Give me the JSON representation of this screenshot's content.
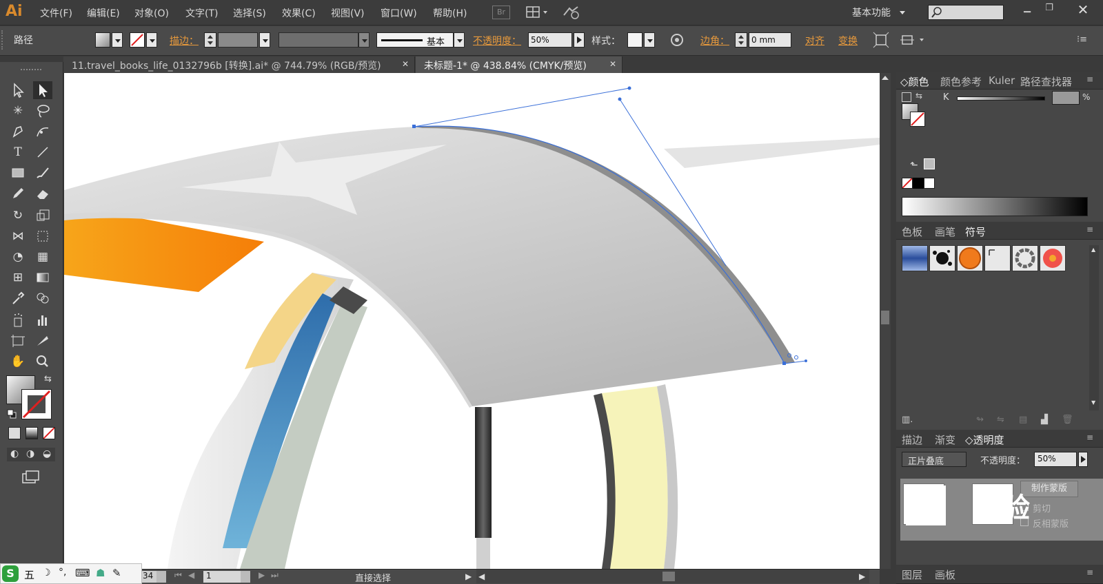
{
  "app": {
    "logo": "Ai"
  },
  "menu": [
    "文件(F)",
    "编辑(E)",
    "对象(O)",
    "文字(T)",
    "选择(S)",
    "效果(C)",
    "视图(V)",
    "窗口(W)",
    "帮助(H)"
  ],
  "bridge_label": "Br",
  "workspace": "基本功能",
  "control": {
    "object_type": "路径",
    "stroke_label": "描边：",
    "brush_label": "基本",
    "opacity_label": "不透明度：",
    "opacity_value": "50%",
    "style_label": "样式：",
    "corner_label": "边角：",
    "corner_value": "0 mm",
    "align_label": "对齐",
    "transform_label": "变换"
  },
  "tabs": [
    {
      "label": "11.travel_books_life_0132796b  [转换].ai* @ 744.79% (RGB/预览)",
      "active": false
    },
    {
      "label": "未标题-1* @ 438.84% (CMYK/预览)",
      "active": true
    }
  ],
  "panels": {
    "color_tabs": [
      "颜色",
      "颜色参考",
      "Kuler",
      "路径查找器"
    ],
    "channel_label": "K",
    "percent_sign": "%",
    "swatch_tabs": [
      "色板",
      "画笔",
      "符号"
    ],
    "transparency_tabs": [
      "描边",
      "渐变",
      "透明度"
    ],
    "blend_mode": "正片叠底",
    "transparency_opacity_label": "不透明度：",
    "transparency_opacity_value": "50%",
    "make_mask_button": "制作蒙版",
    "clip_label": "剪切",
    "invert_mask_label": "反相蒙版",
    "layers_tabs": [
      "图层",
      "画板"
    ]
  },
  "status": {
    "zoom_value": "34",
    "page_value": "1",
    "tool_status": "直接选择"
  },
  "ime": {
    "label": "五"
  },
  "watermark": {
    "text": "经验"
  },
  "colors": {
    "accent_orange": "#e89a3c",
    "selection_blue": "#3a6fd8",
    "ui_dark": "#3c3c3c"
  }
}
